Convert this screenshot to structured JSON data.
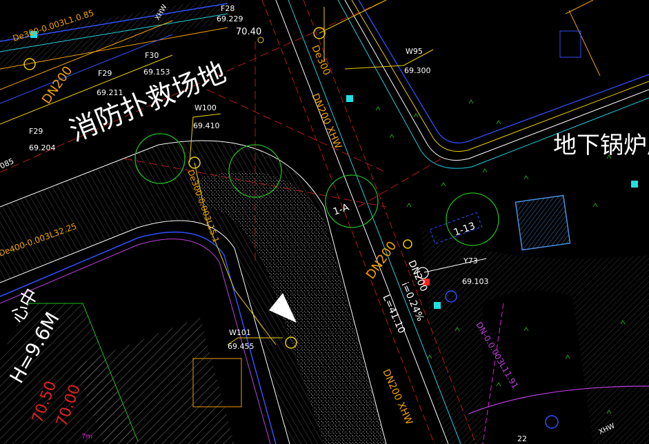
{
  "colors": {
    "background": "#000000",
    "road_edge": "#ffffff",
    "pipe_yellow": "#f0d000",
    "pipe_orange": "#f0a000",
    "pipe_blue": "#3050ff",
    "pipe_cyan": "#20d0e0",
    "dash_red": "#e02020",
    "tree_green": "#20c020",
    "hatch_gray": "#8c8c8c",
    "purple": "#c040e0",
    "magenta": "#e020e0"
  },
  "labels": {
    "fire_rescue_area": "消防扑救场地",
    "underground_boiler_room": "地下锅炉房",
    "building_height": "H=9.6M",
    "center_fragment": "心中",
    "elev_1": "70.50",
    "elev_2": "70.00",
    "tree_1a": "1-A",
    "tree_1_13": "1-13",
    "point_70_40": "70.40",
    "f28": "F28",
    "f28_elev": "69.229",
    "f29a": "F29",
    "f29a_elev": "69.211",
    "f29b": "F29",
    "f29b_elev": "69.204",
    "f30": "F30",
    "f30_elev": "69.153",
    "w95": "W95",
    "w95_elev": "69.300",
    "w100": "W100",
    "w100_elev": "69.410",
    "w101": "W101",
    "w101_elev": "69.455",
    "y73": "Y73",
    "y73_elev": "69.103",
    "left_elev": "085",
    "dn200_a": "DN200",
    "dn200_b": "DN200",
    "dn200_xhw_1": "DN200 XHW",
    "dn200_xhw_2": "DN200 XHW",
    "de300_a": "De300",
    "de300_b": "De300-0.003L15.1",
    "de300_c": "De300-0.003L1.0.85",
    "de400": "De400-0.003L32.25",
    "dn_bottom": "DN200",
    "i_slope": "i=0.24%",
    "length": "L=41.10",
    "xhw_a": "XHW",
    "xhw_b": "XHW",
    "dn_purple": "DN-0.0.003L11.91",
    "fm": "7m",
    "w22": "22"
  }
}
